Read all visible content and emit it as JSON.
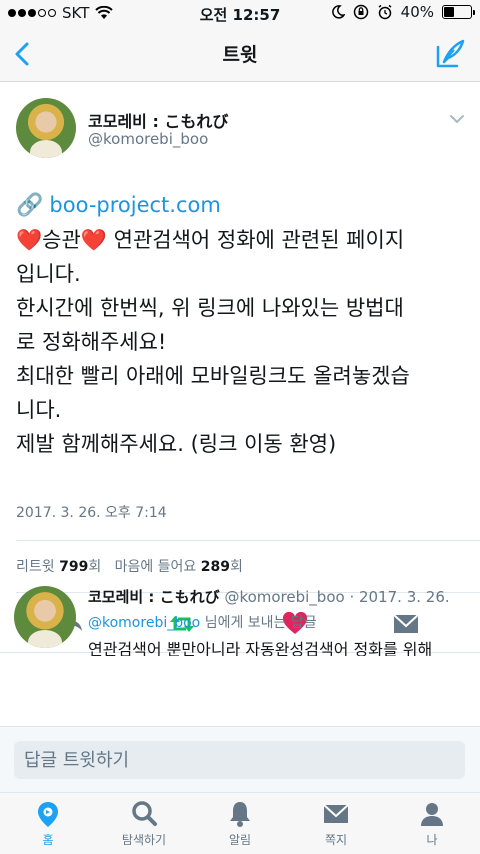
{
  "status_bar": {
    "carrier": "SKT",
    "time": "오전 12:57",
    "battery_percent": "40%",
    "battery_level": 0.4
  },
  "nav": {
    "title": "트윗",
    "back_icon": "chevron-left-icon",
    "compose_icon": "compose-tweet-icon"
  },
  "tweet": {
    "author_name": "코모레비 : こもれび",
    "author_handle": "@komorebi_boo",
    "link_text": "boo-project.com",
    "lines": [
      "승관",
      "연관검색어 정화에 관련된 페이지",
      "입니다.",
      "한시간에 한번씩, 위 링크에 나와있는 방법대",
      "로 정화해주세요!",
      "최대한 빨리 아래에 모바일링크도 올려놓겠습",
      "니다.",
      "제발 함께해주세요. (링크 이동 환영)"
    ],
    "timestamp": "2017. 3. 26. 오후 7:14",
    "retweets_label": "리트윗",
    "retweets_count": "799",
    "retweets_unit": "회",
    "likes_label": "마음에 들어요",
    "likes_count": "289",
    "likes_unit": "회"
  },
  "reply": {
    "author_name": "코모레비 : こもれび",
    "meta": "@komorebi_boo · 2017. 3. 26.",
    "reply_to_handle": "@komorebi_boo",
    "reply_to_suffix": "님에게 보내는 답글",
    "text": "연관검색어 뿐만아니라 자동완성검색어 정화를 위해"
  },
  "reply_bar": {
    "placeholder": "답글 트윗하기"
  },
  "tabs": [
    {
      "label": "홈",
      "icon": "home-icon",
      "active": true
    },
    {
      "label": "탐색하기",
      "icon": "search-icon",
      "active": false
    },
    {
      "label": "알림",
      "icon": "bell-icon",
      "active": false
    },
    {
      "label": "쪽지",
      "icon": "envelope-icon",
      "active": false
    },
    {
      "label": "나",
      "icon": "person-icon",
      "active": false
    }
  ],
  "colors": {
    "accent": "#1da1f2",
    "link": "#1b95e0",
    "retweet": "#17bf63",
    "like": "#e0245e",
    "muted": "#657786"
  }
}
